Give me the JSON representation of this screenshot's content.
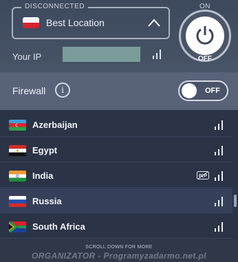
{
  "connection": {
    "status": "DISCONNECTED",
    "location": "Best Location",
    "power_on_label": "ON",
    "power_off_label": "OFF"
  },
  "ip": {
    "label": "Your IP",
    "value": ""
  },
  "firewall": {
    "label": "Firewall",
    "info_symbol": "i",
    "toggle_label": "OFF"
  },
  "countries": [
    {
      "name": "Azerbaijan",
      "flag": "az-flag-icon",
      "p2p": false
    },
    {
      "name": "Egypt",
      "flag": "eg-flag-icon",
      "p2p": false
    },
    {
      "name": "India",
      "flag": "in-flag-icon",
      "p2p": true,
      "p2p_label": "P2P"
    },
    {
      "name": "Russia",
      "flag": "ru-flag-icon",
      "p2p": false
    },
    {
      "name": "South Africa",
      "flag": "za-flag-icon",
      "p2p": false
    }
  ],
  "footer": {
    "scroll_hint": "SCROLL DOWN FOR MORE",
    "watermark": "ORGANIZATOR - Programyzadarmo.net.pl"
  },
  "colors": {
    "background": "#2b3346",
    "firewall_bar": "#58637a",
    "accent": "#ffffff"
  }
}
